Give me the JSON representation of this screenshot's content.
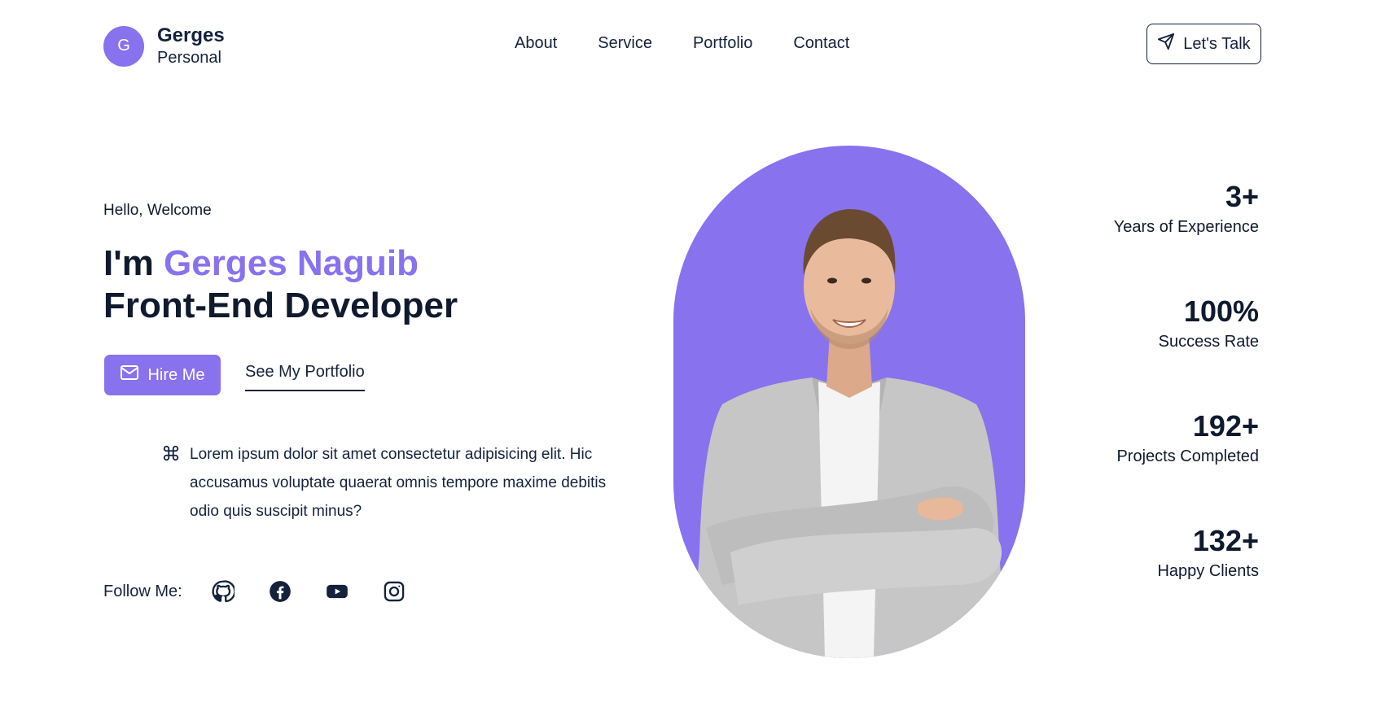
{
  "brand": {
    "initial": "G",
    "name": "Gerges",
    "subtitle": "Personal"
  },
  "nav": {
    "items": [
      "About",
      "Service",
      "Portfolio",
      "Contact"
    ]
  },
  "header": {
    "cta_label": "Let's Talk",
    "cta_icon": "send-icon"
  },
  "hero": {
    "greeting": "Hello, Welcome",
    "intro_prefix": "I'm",
    "name": "Gerges Naguib",
    "role": "Front-End Developer",
    "hire_label": "Hire Me",
    "hire_icon": "mail-icon",
    "portfolio_label": "See My Portfolio",
    "blurb": "Lorem ipsum dolor sit amet consectetur adipisicing elit. Hic accusamus voluptate quaerat omnis tempore maxime debitis odio quis suscipit minus?",
    "blurb_icon": "command-icon"
  },
  "follow": {
    "label": "Follow Me:",
    "icons": [
      "github-icon",
      "facebook-icon",
      "youtube-icon",
      "instagram-icon"
    ]
  },
  "stats": [
    {
      "value": "3+",
      "label": "Years of Experience"
    },
    {
      "value": "100%",
      "label": "Success Rate"
    },
    {
      "value": "192+",
      "label": "Projects Completed"
    },
    {
      "value": "132+",
      "label": "Happy Clients"
    }
  ],
  "colors": {
    "accent": "#8872ee",
    "text": "#14223d",
    "background": "#ffffff"
  }
}
